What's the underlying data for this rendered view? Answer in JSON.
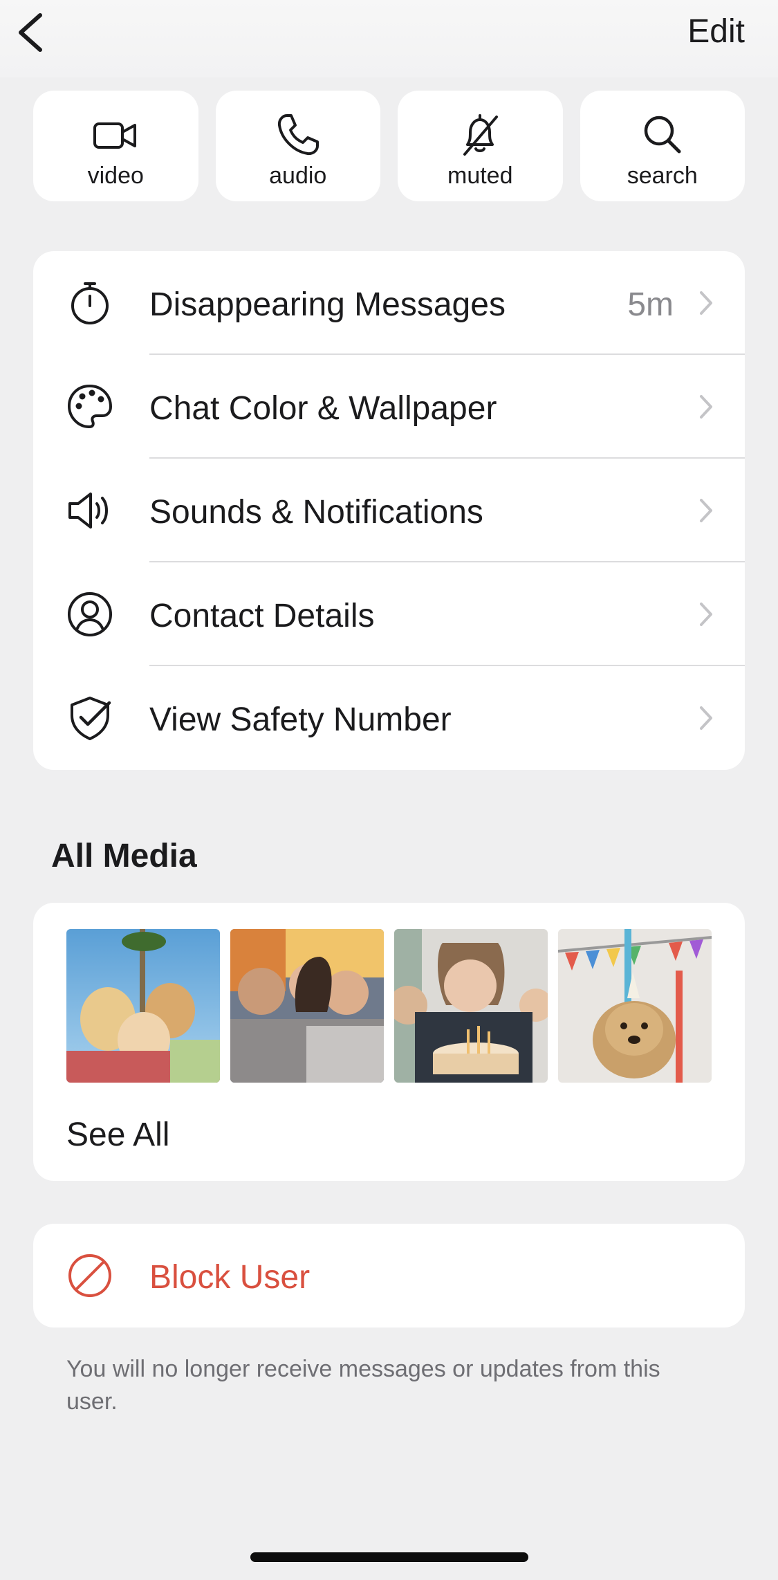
{
  "header": {
    "edit_label": "Edit"
  },
  "actions": [
    {
      "label": "video",
      "icon": "video-camera-icon"
    },
    {
      "label": "audio",
      "icon": "phone-icon"
    },
    {
      "label": "muted",
      "icon": "bell-muted-icon"
    },
    {
      "label": "search",
      "icon": "search-icon"
    }
  ],
  "settings": [
    {
      "label": "Disappearing Messages",
      "value": "5m",
      "icon": "timer-icon"
    },
    {
      "label": "Chat Color & Wallpaper",
      "value": "",
      "icon": "palette-icon"
    },
    {
      "label": "Sounds & Notifications",
      "value": "",
      "icon": "speaker-icon"
    },
    {
      "label": "Contact Details",
      "value": "",
      "icon": "person-circle-icon"
    },
    {
      "label": "View Safety Number",
      "value": "",
      "icon": "shield-check-icon"
    }
  ],
  "media": {
    "title": "All Media",
    "see_all_label": "See All",
    "thumbnails": [
      "group-of-friends-photo",
      "friends-selfie-photo",
      "birthday-cake-photo",
      "dog-party-hat-photo"
    ]
  },
  "block": {
    "label": "Block User",
    "icon": "block-icon",
    "footnote": "You will no longer receive messages or updates from this user.",
    "color": "#d9503f"
  },
  "colors": {
    "background": "#efeff0",
    "card": "#ffffff",
    "text": "#1b1b1d",
    "secondary_text": "#8a8a8e",
    "destructive": "#d9503f"
  }
}
